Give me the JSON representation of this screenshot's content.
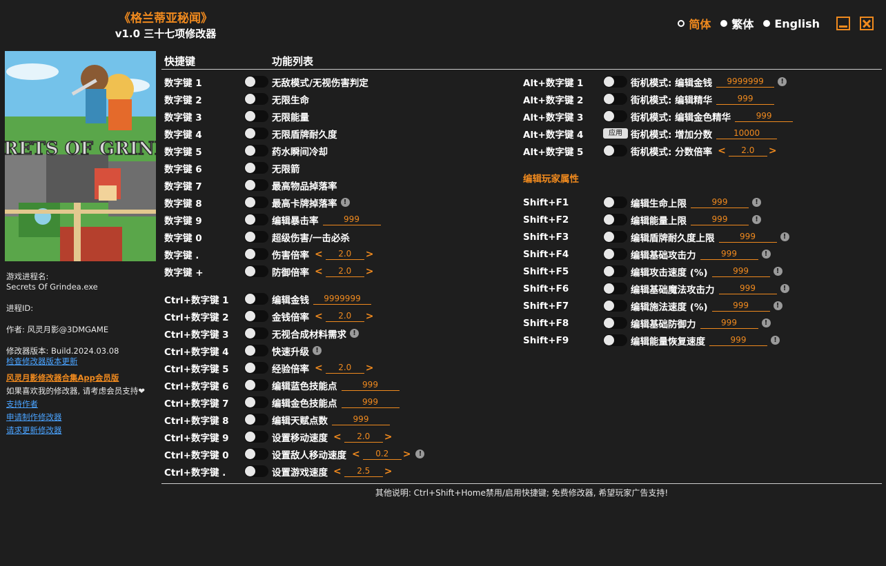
{
  "header": {
    "game_title": "《格兰蒂亚秘闻》",
    "app_title": "v1.0 三十七项修改器"
  },
  "languages": [
    {
      "label": "简体",
      "selected": true
    },
    {
      "label": "繁体",
      "selected": false
    },
    {
      "label": "English",
      "selected": false
    }
  ],
  "columns": {
    "hotkey": "快捷键",
    "features": "功能列表"
  },
  "cover": {
    "logo_text": "SECRETS OF GRINDEA"
  },
  "sidebar": {
    "process_name_label": "游戏进程名:",
    "process_name": "Secrets Of Grindea.exe",
    "process_id_label": "进程ID:",
    "author": "作者: 风灵月影@3DMGAME",
    "version": "修改器版本: Build.2024.03.08",
    "check_update": "检查修改器版本更新",
    "app_vip": "风灵月影修改器合集App会员版",
    "support_text": "如果喜欢我的修改器, 请考虑会员支持",
    "heart": "❤",
    "links": [
      "支持作者",
      "申请制作修改器",
      "请求更新修改器"
    ]
  },
  "section_player": "编辑玩家属性",
  "footer": "其他说明: Ctrl+Shift+Home禁用/启用快捷键; 免费修改器, 希望玩家广告支持!",
  "left_rows": [
    {
      "key": "数字键 1",
      "label": "无敌模式/无视伤害判定"
    },
    {
      "key": "数字键 2",
      "label": "无限生命"
    },
    {
      "key": "数字键 3",
      "label": "无限能量"
    },
    {
      "key": "数字键 4",
      "label": "无限盾牌耐久度"
    },
    {
      "key": "数字键 5",
      "label": "药水瞬间冷却"
    },
    {
      "key": "数字键 6",
      "label": "无限箭"
    },
    {
      "key": "数字键 7",
      "label": "最高物品掉落率"
    },
    {
      "key": "数字键 8",
      "label": "最高卡牌掉落率",
      "info": "!"
    },
    {
      "key": "数字键 9",
      "label": "编辑暴击率",
      "value": "999",
      "vw": 84
    },
    {
      "key": "数字键 0",
      "label": "超级伤害/一击必杀"
    },
    {
      "key": "数字键 .",
      "label": "伤害倍率",
      "value": "2.0",
      "stepper": true
    },
    {
      "key": "数字键 +",
      "label": "防御倍率",
      "value": "2.0",
      "stepper": true
    },
    {
      "key": "Ctrl+数字键 1",
      "label": "编辑金钱",
      "value": "9999999",
      "vw": 84
    },
    {
      "key": "Ctrl+数字键 2",
      "label": "金钱倍率",
      "value": "2.0",
      "stepper": true
    },
    {
      "key": "Ctrl+数字键 3",
      "label": "无视合成材料需求",
      "info": "!"
    },
    {
      "key": "Ctrl+数字键 4",
      "label": "快速升级",
      "info": "!"
    },
    {
      "key": "Ctrl+数字键 5",
      "label": "经验倍率",
      "value": "2.0",
      "stepper": true
    },
    {
      "key": "Ctrl+数字键 6",
      "label": "编辑蓝色技能点",
      "value": "999",
      "vw": 84
    },
    {
      "key": "Ctrl+数字键 7",
      "label": "编辑金色技能点",
      "value": "999",
      "vw": 84
    },
    {
      "key": "Ctrl+数字键 8",
      "label": "编辑天赋点数",
      "value": "999",
      "vw": 84
    },
    {
      "key": "Ctrl+数字键 9",
      "label": "设置移动速度",
      "value": "2.0",
      "stepper": true
    },
    {
      "key": "Ctrl+数字键 0",
      "label": "设置敌人移动速度",
      "value": "0.2",
      "stepper": true,
      "info": "!"
    },
    {
      "key": "Ctrl+数字键 .",
      "label": "设置游戏速度",
      "value": "2.5",
      "stepper": true
    }
  ],
  "right_rows": [
    {
      "key": "Alt+数字键 1",
      "label": "街机模式: 编辑金钱",
      "value": "9999999",
      "vw": 84,
      "info": "!"
    },
    {
      "key": "Alt+数字键 2",
      "label": "街机模式: 编辑精华",
      "value": "999",
      "vw": 84
    },
    {
      "key": "Alt+数字键 3",
      "label": "街机模式: 编辑金色精华",
      "value": "999",
      "vw": 84
    },
    {
      "key": "Alt+数字键 4",
      "label": "街机模式: 增加分数",
      "value": "10000",
      "vw": 88,
      "apply": "应用"
    },
    {
      "key": "Alt+数字键 5",
      "label": "街机模式: 分数倍率",
      "value": "2.0",
      "stepper": true
    }
  ],
  "player_rows": [
    {
      "key": "Shift+F1",
      "label": "编辑生命上限",
      "value": "999",
      "vw": 84,
      "info": "!"
    },
    {
      "key": "Shift+F2",
      "label": "编辑能量上限",
      "value": "999",
      "vw": 84,
      "info": "!"
    },
    {
      "key": "Shift+F3",
      "label": "编辑盾牌耐久度上限",
      "value": "999",
      "vw": 84,
      "info": "!"
    },
    {
      "key": "Shift+F4",
      "label": "编辑基础攻击力",
      "value": "999",
      "vw": 84,
      "info": "!"
    },
    {
      "key": "Shift+F5",
      "label": "编辑攻击速度 (%)",
      "value": "999",
      "vw": 84,
      "info": "!"
    },
    {
      "key": "Shift+F6",
      "label": "编辑基础魔法攻击力",
      "value": "999",
      "vw": 84,
      "info": "!"
    },
    {
      "key": "Shift+F7",
      "label": "编辑施法速度 (%)",
      "value": "999",
      "vw": 84,
      "info": "!"
    },
    {
      "key": "Shift+F8",
      "label": "编辑基础防御力",
      "value": "999",
      "vw": 84,
      "info": "!"
    },
    {
      "key": "Shift+F9",
      "label": "编辑能量恢复速度",
      "value": "999",
      "vw": 84,
      "info": "!"
    }
  ]
}
